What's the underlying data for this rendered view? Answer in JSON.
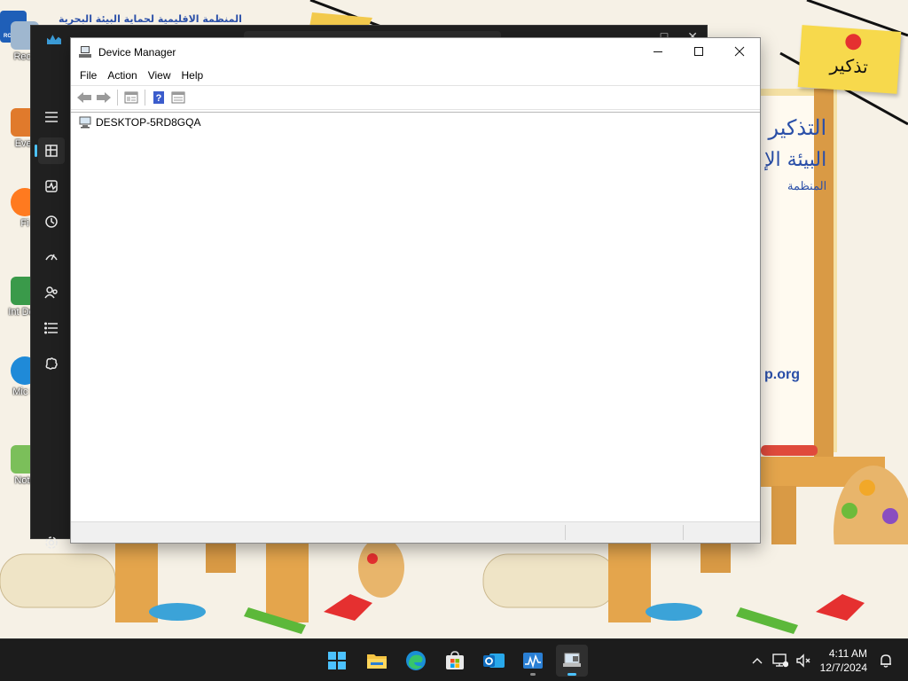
{
  "device_manager": {
    "title": "Device Manager",
    "menu": [
      "File",
      "Action",
      "View",
      "Help"
    ],
    "toolbar": [
      "back-icon",
      "forward-icon",
      "properties-icon",
      "help-icon",
      "show-hidden-icon"
    ],
    "tree_root": "DESKTOP-5RD8GQA",
    "window_controls": [
      "minimize-icon",
      "maximize-icon",
      "close-icon"
    ]
  },
  "task_manager": {
    "nav": [
      "hamburger-icon",
      "processes-icon",
      "performance-icon",
      "app-history-icon",
      "startup-apps-icon",
      "users-icon",
      "details-icon",
      "services-icon",
      "settings-icon"
    ],
    "active_nav": "processes-icon"
  },
  "desktop": {
    "icons": [
      "Recy",
      "Ever",
      "Fi",
      "Int Dow",
      "Mic E",
      "Note"
    ],
    "wallpaper": {
      "header": "المنظمة الاقليمية لحماية البيئة البحرية",
      "sticky_note": "تذكير",
      "board_line1": "التذكير",
      "board_line2": "البيئة الإ",
      "board_line3": "المنظمة",
      "board_url": "p.org",
      "logo_text": "ROPME"
    }
  },
  "taskbar": {
    "apps": [
      "start-icon",
      "file-explorer-icon",
      "edge-icon",
      "store-icon",
      "outlook-icon",
      "task-manager-icon",
      "device-manager-icon"
    ],
    "active_app": "device-manager-icon",
    "tray": [
      "chevron-up-icon",
      "network-icon",
      "volume-muted-icon"
    ],
    "time": "4:11 AM",
    "date": "12/7/2024",
    "accent": "#4cc2ff"
  }
}
